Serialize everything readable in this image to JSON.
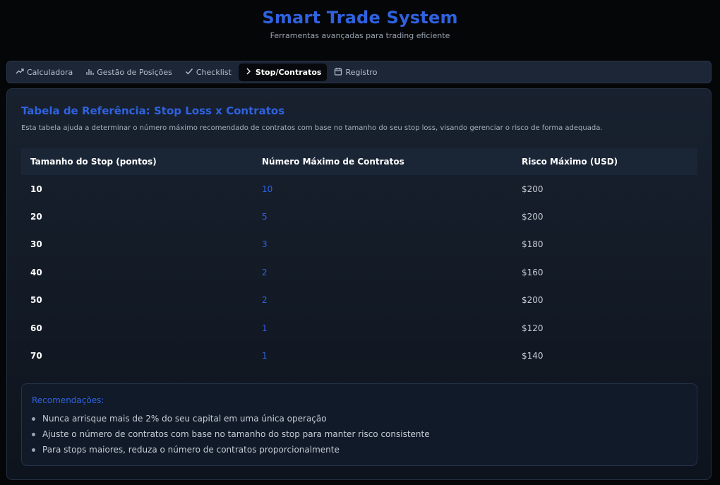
{
  "header": {
    "title": "Smart Trade System",
    "subtitle": "Ferramentas avançadas para trading eficiente"
  },
  "tabs": [
    {
      "label": "Calculadora",
      "icon": "trending-up-icon",
      "active": false
    },
    {
      "label": "Gestão de Posições",
      "icon": "bar-chart-icon",
      "active": false
    },
    {
      "label": "Checklist",
      "icon": "check-icon",
      "active": false
    },
    {
      "label": "Stop/Contratos",
      "icon": "chevron-right-icon",
      "active": true
    },
    {
      "label": "Registro",
      "icon": "calendar-icon",
      "active": false
    }
  ],
  "card": {
    "title": "Tabela de Referência: Stop Loss x Contratos",
    "description": "Esta tabela ajuda a determinar o número máximo recomendado de contratos com base no tamanho do seu stop loss, visando gerenciar o risco de forma adequada."
  },
  "table": {
    "headers": [
      "Tamanho do Stop (pontos)",
      "Número Máximo de Contratos",
      "Risco Máximo (USD)"
    ],
    "rows": [
      [
        "10",
        "10",
        "$200"
      ],
      [
        "20",
        "5",
        "$200"
      ],
      [
        "30",
        "3",
        "$180"
      ],
      [
        "40",
        "2",
        "$160"
      ],
      [
        "50",
        "2",
        "$200"
      ],
      [
        "60",
        "1",
        "$120"
      ],
      [
        "70",
        "1",
        "$140"
      ]
    ]
  },
  "recommendations": {
    "title": "Recomendações:",
    "items": [
      "Nunca arrisque mais de 2% do seu capital em uma única operação",
      "Ajuste o número de contratos com base no tamanho do stop para manter risco consistente",
      "Para stops maiores, reduza o número de contratos proporcionalmente"
    ]
  },
  "colors": {
    "accent": "#2f62e0",
    "background": "#050608",
    "active_tab": "#07090c"
  }
}
